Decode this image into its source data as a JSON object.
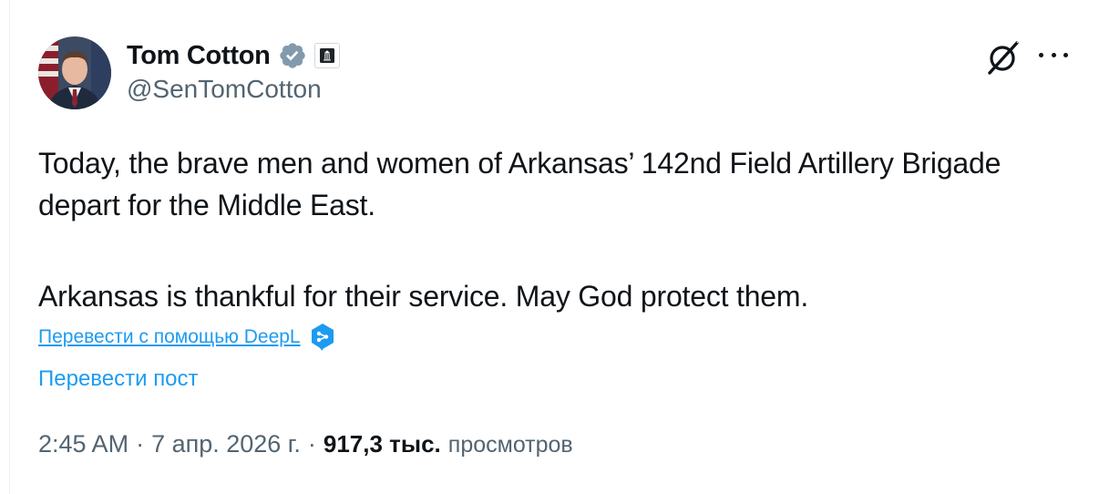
{
  "author": {
    "display_name": "Tom Cotton",
    "handle": "@SenTomCotton",
    "verified_color": "#829aab"
  },
  "header_icons": {
    "grok": "grok-icon",
    "more": "more-options-icon"
  },
  "tweet": {
    "paragraph_1": "Today, the brave men and women of Arkansas’ 142nd Field Artillery Brigade depart for the Middle East.",
    "paragraph_2": "Arkansas is thankful for their service. May God protect them."
  },
  "translation": {
    "deepl_link": "Перевести с помощью DeepL",
    "translate_post": "Перевести пост"
  },
  "meta": {
    "time": "2:45 AM",
    "separator": "·",
    "date": "7 апр. 2026 г.",
    "views_count": "917,3 тыс.",
    "views_label": "просмотров"
  },
  "colors": {
    "link": "#1d9bf0",
    "secondary_text": "#536471",
    "primary_text": "#0f1419"
  }
}
